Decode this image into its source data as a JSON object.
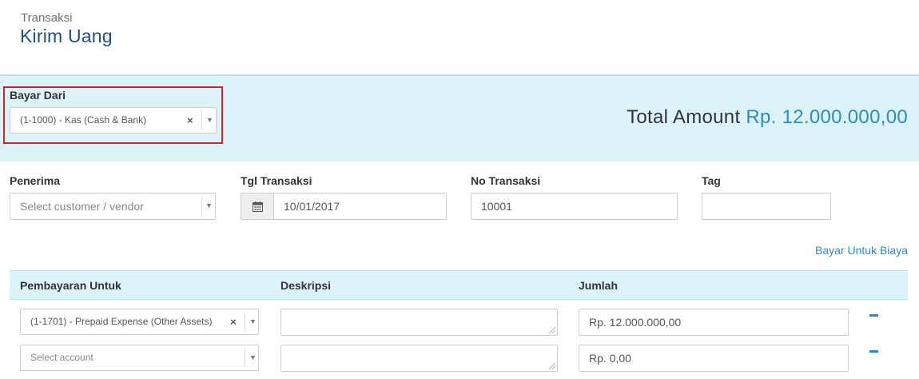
{
  "header": {
    "breadcrumb": "Transaksi",
    "title": "Kirim Uang"
  },
  "pay_from": {
    "label": "Bayar Dari",
    "selected": "(1-1000) - Kas (Cash & Bank)"
  },
  "total": {
    "label": "Total Amount",
    "amount": "Rp. 12.000.000,00"
  },
  "form": {
    "recipient_label": "Penerima",
    "recipient_placeholder": "Select customer / vendor",
    "date_label": "Tgl Transaksi",
    "date_value": "10/01/2017",
    "number_label": "No Transaksi",
    "number_value": "10001",
    "tag_label": "Tag",
    "tag_value": ""
  },
  "expense_link": "Bayar Untuk Biaya",
  "table": {
    "columns": [
      "Pembayaran Untuk",
      "Deskripsi",
      "Jumlah"
    ],
    "rows": [
      {
        "account": "(1-1701) - Prepaid Expense (Other Assets)",
        "description": "",
        "amount": "Rp. 12.000.000,00"
      },
      {
        "account": "Select account",
        "description": "",
        "amount": "Rp. 0,00"
      }
    ]
  },
  "colors": {
    "title": "#1c4e8c",
    "accent": "#2a8bc8",
    "panel_bg": "#dcf3fa",
    "highlight": "#d9212c"
  }
}
